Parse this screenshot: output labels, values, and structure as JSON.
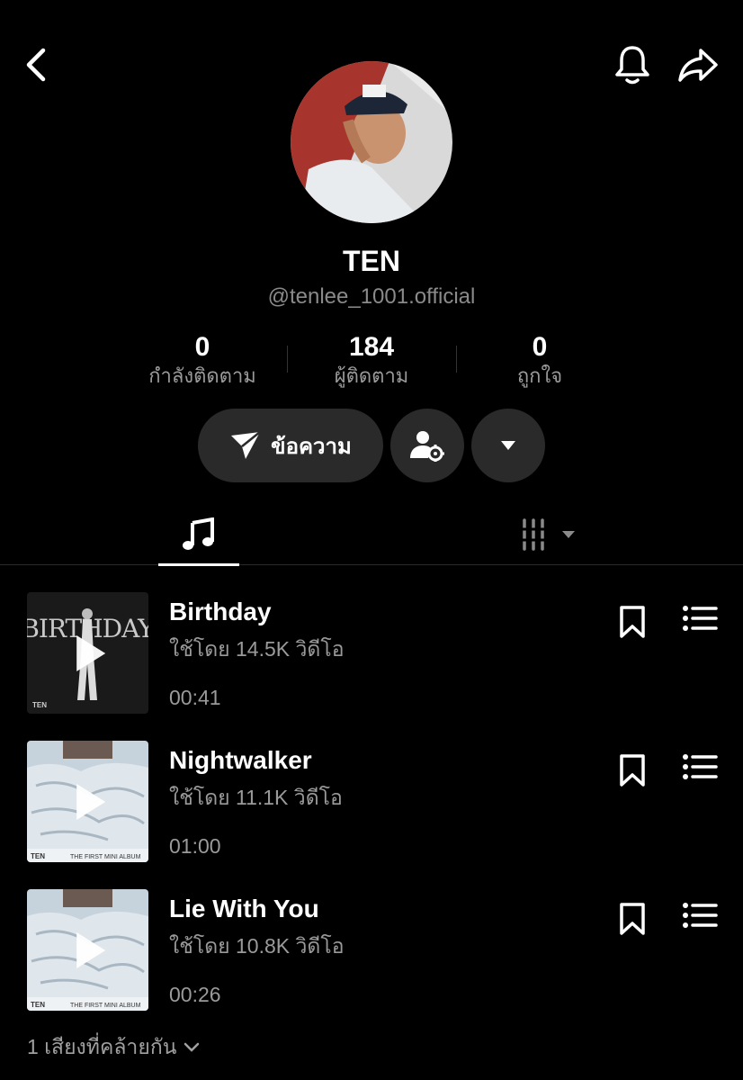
{
  "header": {
    "back_icon": "chevron-left-icon",
    "bell_icon": "bell-icon",
    "share_icon": "share-arrow-icon"
  },
  "profile": {
    "name": "TEN",
    "handle": "@tenlee_1001.official",
    "stats": [
      {
        "value": "0",
        "label": "กำลังติดตาม"
      },
      {
        "value": "184",
        "label": "ผู้ติดตาม"
      },
      {
        "value": "0",
        "label": "ถูกใจ"
      }
    ]
  },
  "actions": {
    "message_label": "ข้อความ"
  },
  "tabs": [
    {
      "icon": "music-note-icon"
    },
    {
      "icon": "playlist-grid-icon"
    }
  ],
  "tracks": [
    {
      "title": "Birthday",
      "uses": "ใช้โดย 14.5K วิดีโอ",
      "duration": "00:41",
      "cover_text": "BIRTHDAY",
      "cover_artist": "TEN"
    },
    {
      "title": "Nightwalker",
      "uses": "ใช้โดย 11.1K วิดีโอ",
      "duration": "01:00",
      "cover_artist": "TEN",
      "cover_text": "THE FIRST MINI ALBUM"
    },
    {
      "title": "Lie With You",
      "uses": "ใช้โดย 10.8K วิดีโอ",
      "duration": "00:26",
      "cover_artist": "TEN",
      "cover_text": "THE FIRST MINI ALBUM"
    }
  ],
  "footer": {
    "similar_label": "1 เสียงที่คล้ายกัน"
  },
  "colors": {
    "background": "#000000",
    "pill": "#2a2a2a",
    "muted_text": "#9a9a9a"
  }
}
